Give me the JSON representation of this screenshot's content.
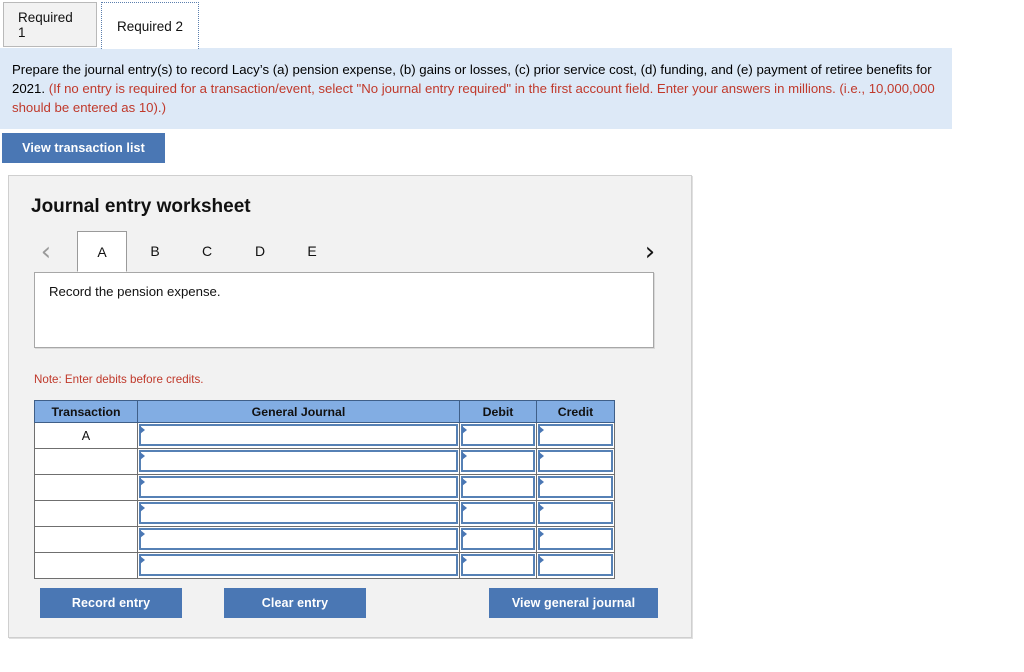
{
  "tabs": [
    {
      "label": "Required 1",
      "active": false
    },
    {
      "label": "Required 2",
      "active": true
    }
  ],
  "banner": {
    "black_text": "Prepare the journal entry(s) to record Lacy’s (a) pension expense, (b) gains or losses, (c) prior service cost, (d) funding, and (e) payment of retiree benefits for 2021.",
    "red_text": "(If no entry is required for a transaction/event, select \"No journal entry required\" in the first account field. Enter your answers in millions. (i.e., 10,000,000 should be entered as 10).)"
  },
  "view_transaction_list_label": "View transaction list",
  "worksheet": {
    "title": "Journal entry worksheet",
    "prev_icon": "chevron-left-icon",
    "next_icon": "chevron-right-icon",
    "letter_tabs": [
      {
        "label": "A",
        "active": true
      },
      {
        "label": "B",
        "active": false
      },
      {
        "label": "C",
        "active": false
      },
      {
        "label": "D",
        "active": false
      },
      {
        "label": "E",
        "active": false
      }
    ],
    "prompt": "Record the pension expense.",
    "note": "Note: Enter debits before credits.",
    "table": {
      "headers": [
        "Transaction",
        "General Journal",
        "Debit",
        "Credit"
      ],
      "rows": [
        {
          "transaction": "A",
          "general_journal": "",
          "debit": "",
          "credit": ""
        },
        {
          "transaction": "",
          "general_journal": "",
          "debit": "",
          "credit": ""
        },
        {
          "transaction": "",
          "general_journal": "",
          "debit": "",
          "credit": ""
        },
        {
          "transaction": "",
          "general_journal": "",
          "debit": "",
          "credit": ""
        },
        {
          "transaction": "",
          "general_journal": "",
          "debit": "",
          "credit": ""
        },
        {
          "transaction": "",
          "general_journal": "",
          "debit": "",
          "credit": ""
        }
      ]
    },
    "buttons": {
      "record": "Record entry",
      "clear": "Clear entry",
      "view_journal": "View general journal"
    }
  },
  "colors": {
    "button_blue": "#4a77b4",
    "header_blue": "#82ade3",
    "banner_blue": "#dde9f7",
    "note_red": "#c0392b",
    "field_border": "#5681b5"
  }
}
